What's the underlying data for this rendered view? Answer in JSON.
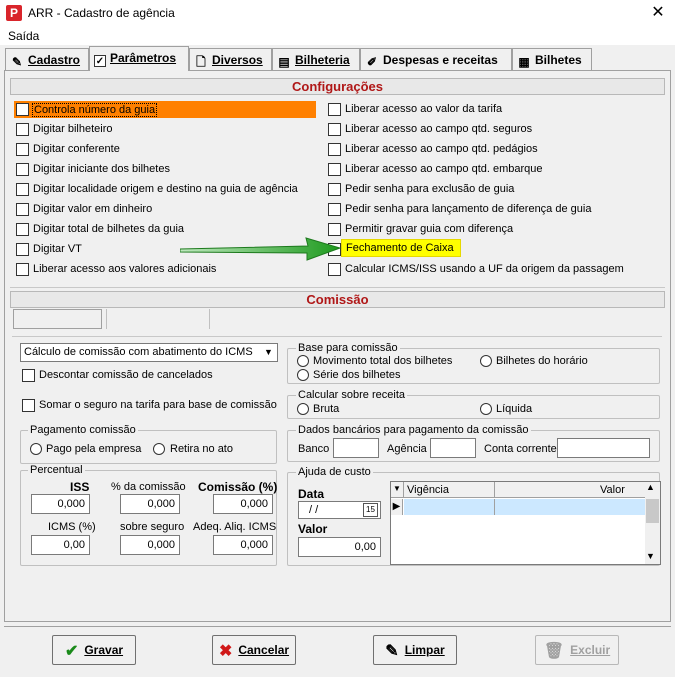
{
  "window": {
    "title": "ARR - Cadastro de agência",
    "close_glyph": "✕"
  },
  "menu": {
    "saida": "Saída"
  },
  "tabs": [
    {
      "label": "Cadastro",
      "icon": "pencil-icon"
    },
    {
      "label": "Parâmetros",
      "icon": "checkbox-icon"
    },
    {
      "label": "Diversos",
      "icon": "page-icon"
    },
    {
      "label": "Bilheteria",
      "icon": "document-icon"
    },
    {
      "label": "Despesas e receitas",
      "icon": "edit-doc-icon"
    },
    {
      "label": "Bilhetes",
      "icon": "list-doc-icon"
    }
  ],
  "configuracoes": {
    "header": "Configurações",
    "left": [
      "Controla número da guia",
      "Digitar bilheteiro",
      "Digitar conferente",
      "Digitar iniciante dos bilhetes",
      "Digitar localidade origem e destino na guia de agência",
      "Digitar valor em dinheiro",
      "Digitar total de bilhetes da guia",
      "Digitar VT",
      "Liberar acesso aos valores adicionais"
    ],
    "right": [
      "Liberar acesso ao valor da tarifa",
      "Liberar acesso ao campo qtd. seguros",
      "Liberar acesso ao campo qtd. pedágios",
      "Liberar acesso ao campo qtd. embarque",
      "Pedir senha para exclusão de guia",
      "Pedir senha para lançamento de diferença de guia",
      "Permitir gravar guia com diferença",
      "Fechamento de Caixa",
      "Calcular ICMS/ISS usando a UF da origem da passagem"
    ],
    "highlight_color": "#ff8000",
    "tag_color": "#ffff00",
    "arrow_color": "#22a022"
  },
  "comissao": {
    "header": "Comissão",
    "calc_select": "Cálculo de comissão com abatimento do ICMS",
    "descontar": "Descontar comissão de cancelados",
    "somar_seguro": "Somar o seguro na tarifa para base de comissão",
    "pagamento": {
      "title": "Pagamento comissão",
      "opt1": "Pago pela empresa",
      "opt2": "Retira no ato"
    },
    "percentual": {
      "title": "Percentual",
      "iss": "ISS",
      "da_comissao": "% da comissão",
      "comissao": "Comissão (%)",
      "v_iss": "0,000",
      "v_da_comissao": "0,000",
      "v_comissao": "0,000",
      "icms": "ICMS (%)",
      "sobre_seguro": "sobre seguro",
      "adeq": "Adeq. Aliq. ICMS",
      "v_icms": "0,00",
      "v_sobre_seguro": "0,000",
      "v_adeq": "0,000"
    },
    "base": {
      "title": "Base para comissão",
      "opt1": "Movimento total dos bilhetes",
      "opt2": "Bilhetes do horário",
      "opt3": "Série dos bilhetes"
    },
    "calcular": {
      "title": "Calcular sobre receita",
      "opt1": "Bruta",
      "opt2": "Líquida"
    },
    "dados": {
      "title": "Dados bancários para pagamento da comissão",
      "banco": "Banco",
      "agencia": "Agência",
      "conta": "Conta corrente"
    },
    "ajuda": {
      "title": "Ajuda de custo",
      "data": "Data",
      "data_value": "/  /",
      "valor": "Valor",
      "valor_value": "0,00",
      "col_vigencia": "Vigência",
      "col_valor": "Valor"
    }
  },
  "buttons": {
    "gravar": "Gravar",
    "cancelar": "Cancelar",
    "limpar": "Limpar",
    "excluir": "Excluir"
  }
}
